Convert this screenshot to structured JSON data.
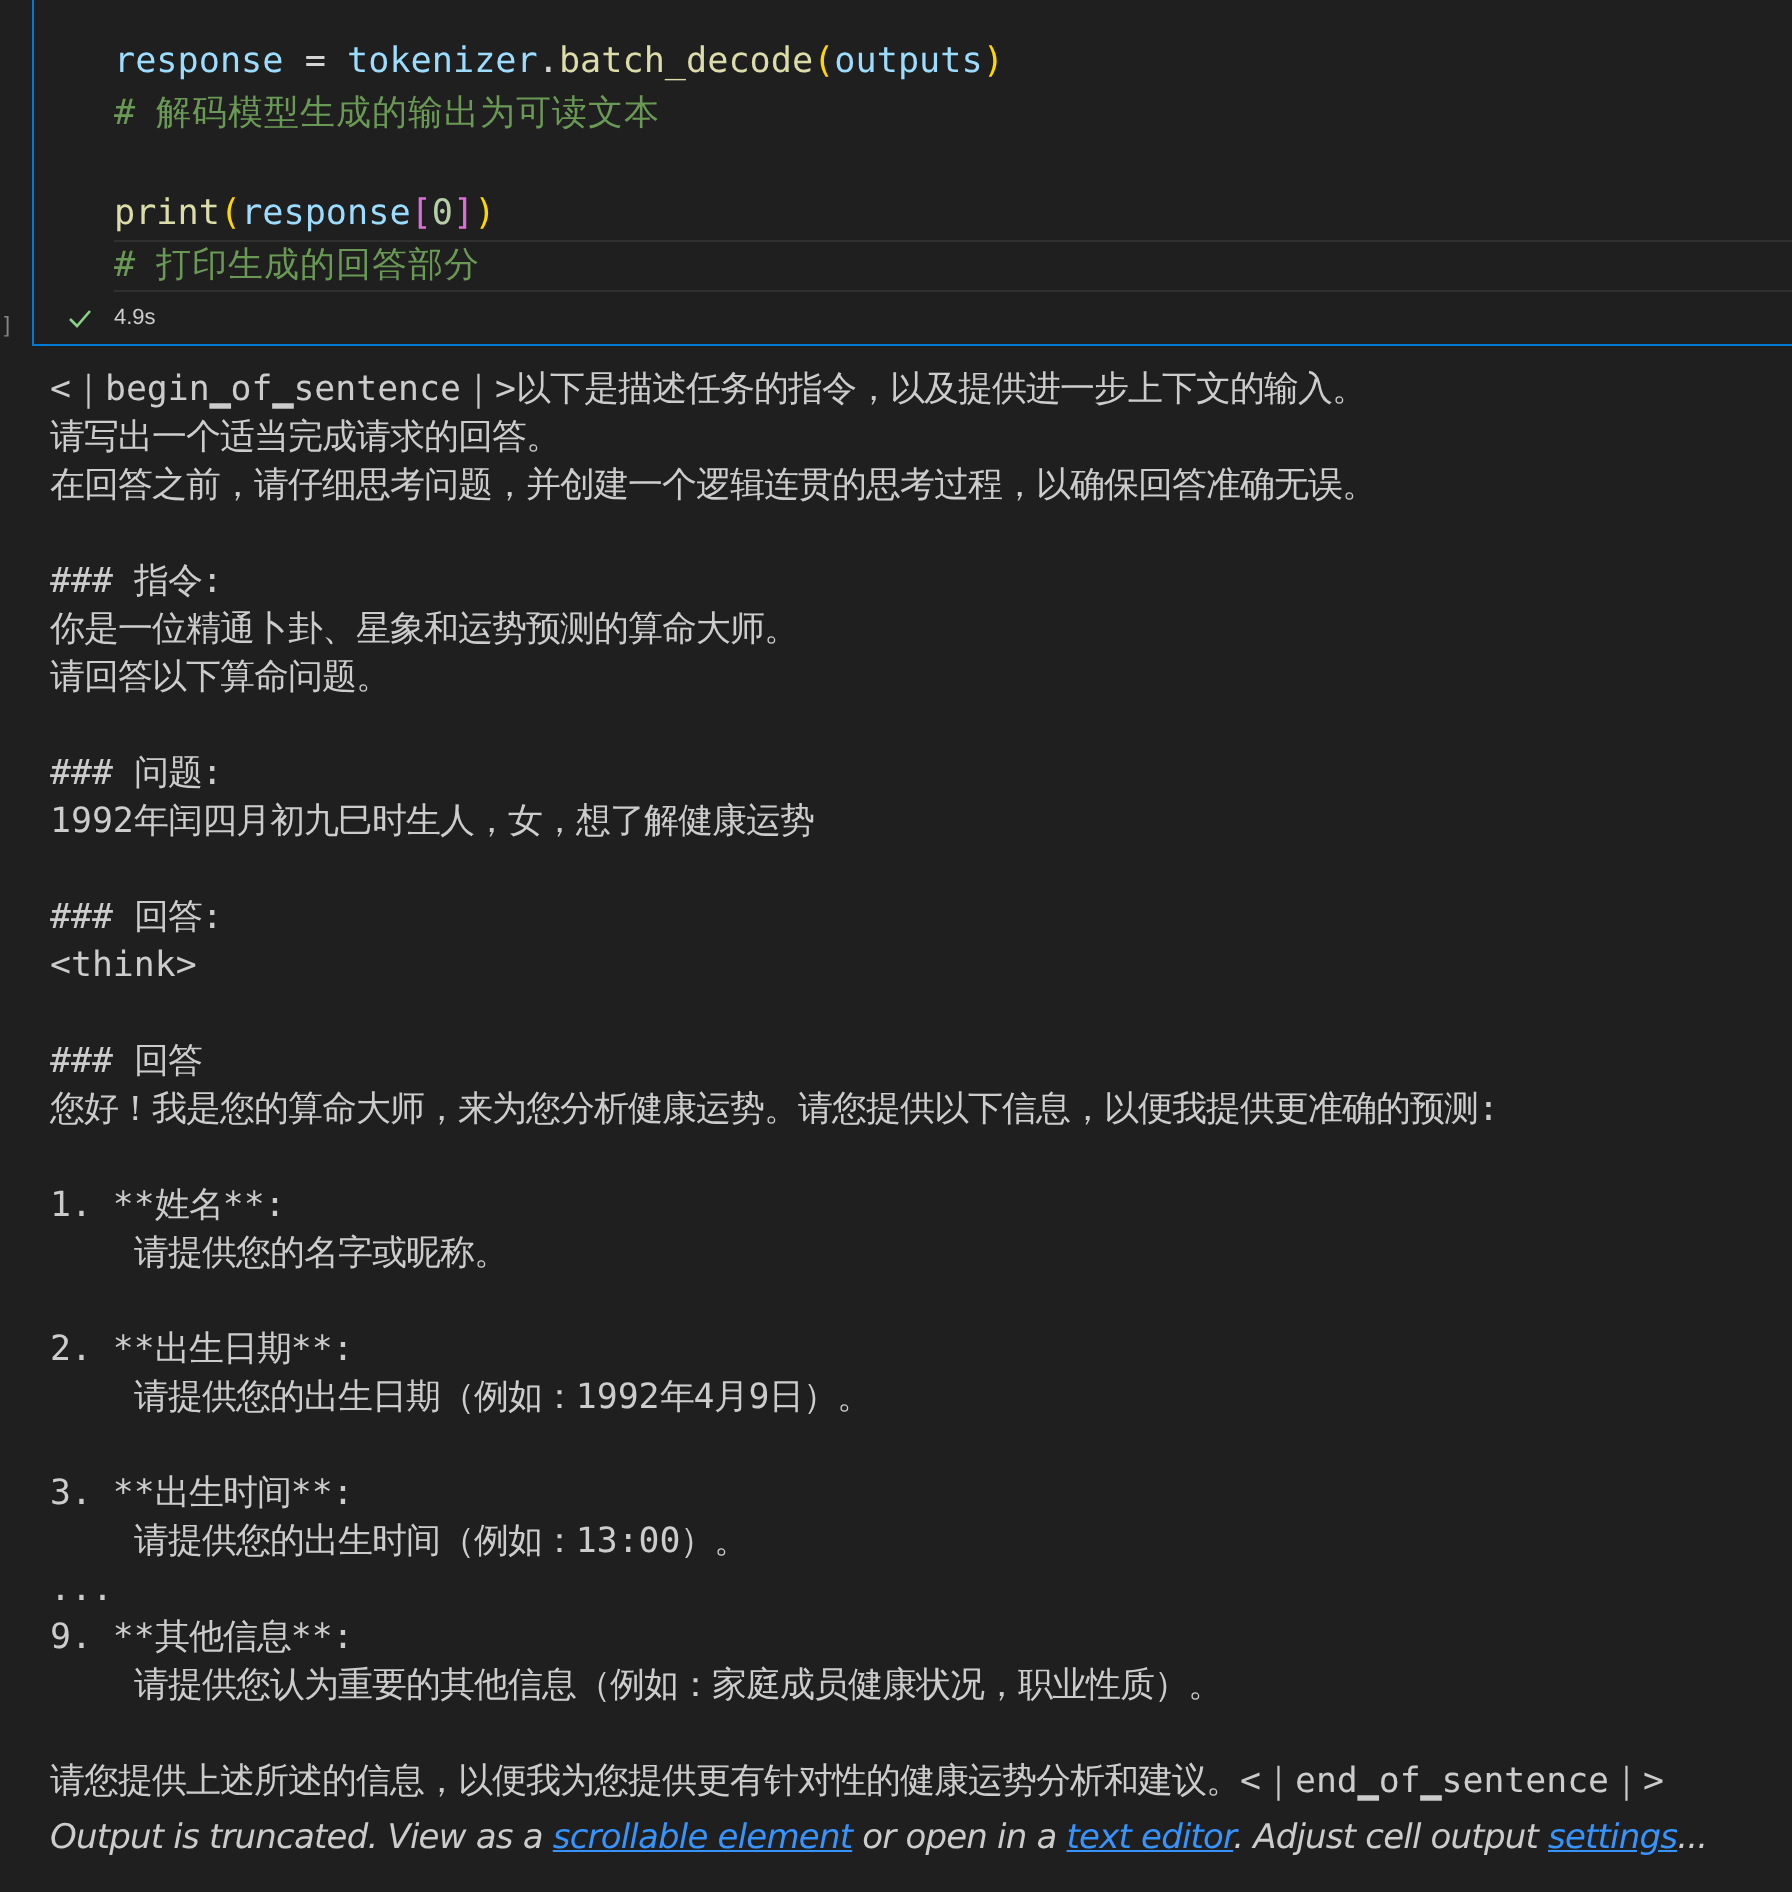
{
  "code_cell": {
    "line_groups": [
      [
        [
          {
            "text": "response",
            "kind": "variable"
          },
          {
            "text": " = ",
            "kind": "operator"
          },
          {
            "text": "tokenizer",
            "kind": "variable"
          },
          {
            "text": ".",
            "kind": "operator"
          },
          {
            "text": "batch_decode",
            "kind": "function"
          },
          {
            "text": "(",
            "kind": "paren"
          },
          {
            "text": "outputs",
            "kind": "variable"
          },
          {
            "text": ")",
            "kind": "paren"
          }
        ],
        [
          {
            "text": "# 解码模型生成的输出为可读文本",
            "kind": "comment"
          }
        ]
      ],
      [
        [
          {
            "text": "print",
            "kind": "function"
          },
          {
            "text": "(",
            "kind": "paren"
          },
          {
            "text": "response",
            "kind": "variable"
          },
          {
            "text": "[",
            "kind": "bracket"
          },
          {
            "text": "0",
            "kind": "number"
          },
          {
            "text": "]",
            "kind": "bracket"
          },
          {
            "text": ")",
            "kind": "paren"
          }
        ],
        [
          {
            "text": "# 打印生成的回答部分",
            "kind": "comment",
            "current": true
          }
        ]
      ]
    ],
    "execution_count": "]",
    "status": {
      "succeeded": true,
      "duration": "4.9s"
    }
  },
  "output": {
    "blocks": [
      [
        "<｜begin▁of▁sentence｜>以下是描述任务的指令，以及提供进一步上下文的输入。",
        "请写出一个适当完成请求的回答。",
        "在回答之前，请仔细思考问题，并创建一个逻辑连贯的思考过程，以确保回答准确无误。"
      ],
      [
        "### 指令:",
        "你是一位精通卜卦、星象和运势预测的算命大师。",
        "请回答以下算命问题。"
      ],
      [
        "### 问题:",
        "1992年闰四月初九巳时生人，女，想了解健康运势"
      ],
      [
        "### 回答:",
        "<think>"
      ],
      [
        "### 回答",
        "您好！我是您的算命大师，来为您分析健康运势。请您提供以下信息，以便我提供更准确的预测:"
      ],
      [
        "1. **姓名**:",
        "    请提供您的名字或昵称。"
      ],
      [
        "2. **出生日期**:",
        "    请提供您的出生日期（例如：1992年4月9日）。"
      ],
      [
        "3. **出生时间**:",
        "    请提供您的出生时间（例如：13:00）。",
        "...",
        "9. **其他信息**:",
        "    请提供您认为重要的其他信息（例如：家庭成员健康状况，职业性质）。"
      ],
      [
        "请您提供上述所述的信息，以便我为您提供更有针对性的健康运势分析和建议。<｜end▁of▁sentence｜>"
      ]
    ],
    "truncation_notice": [
      {
        "kind": "text",
        "text": "Output is truncated. View as a "
      },
      {
        "kind": "link",
        "text": "scrollable element"
      },
      {
        "kind": "text",
        "text": " or open in a "
      },
      {
        "kind": "link",
        "text": "text editor"
      },
      {
        "kind": "text",
        "text": ". Adjust cell output "
      },
      {
        "kind": "link",
        "text": "settings"
      },
      {
        "kind": "text",
        "text": "..."
      }
    ]
  }
}
